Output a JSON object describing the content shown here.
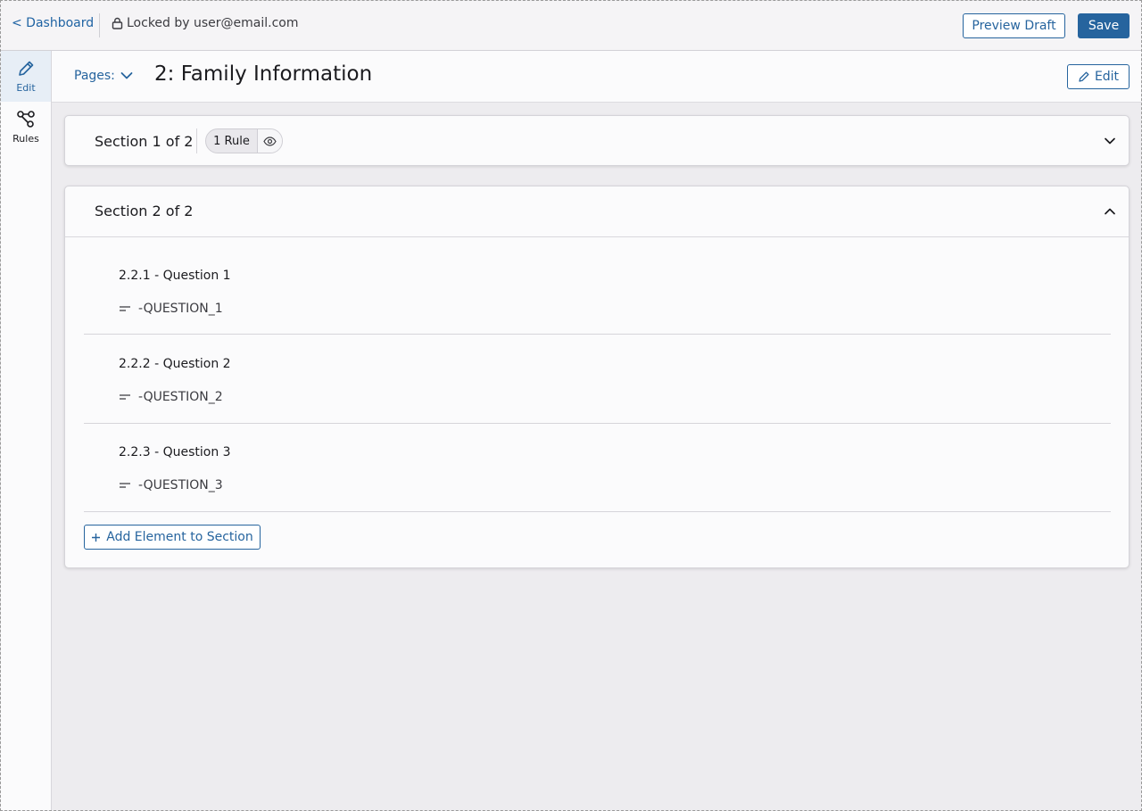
{
  "topbar": {
    "back_label": "< Dashboard",
    "lock_status": "Locked by user@email.com",
    "preview_label": "Preview Draft",
    "save_label": "Save"
  },
  "rail": {
    "items": [
      {
        "label": "Edit",
        "icon": "pencil-icon",
        "active": true
      },
      {
        "label": "Rules",
        "icon": "rules-nodes-icon",
        "active": false
      }
    ]
  },
  "header": {
    "pages_label": "Pages:",
    "title": "2: Family Information",
    "edit_label": "Edit"
  },
  "sections": [
    {
      "title": "Section 1 of 2",
      "rule_badge": "1 Rule",
      "expanded": false
    },
    {
      "title": "Section 2 of 2",
      "expanded": true,
      "questions": [
        {
          "title": "2.2.1 - Question 1",
          "key": "-QUESTION_1"
        },
        {
          "title": "2.2.2 - Question 2",
          "key": "-QUESTION_2"
        },
        {
          "title": "2.2.3 - Question 3",
          "key": "-QUESTION_3"
        }
      ],
      "add_label": "Add Element to Section"
    }
  ],
  "colors": {
    "accent": "#26649e",
    "page_background": "#edecef",
    "card_background": "#fbfbfc"
  }
}
